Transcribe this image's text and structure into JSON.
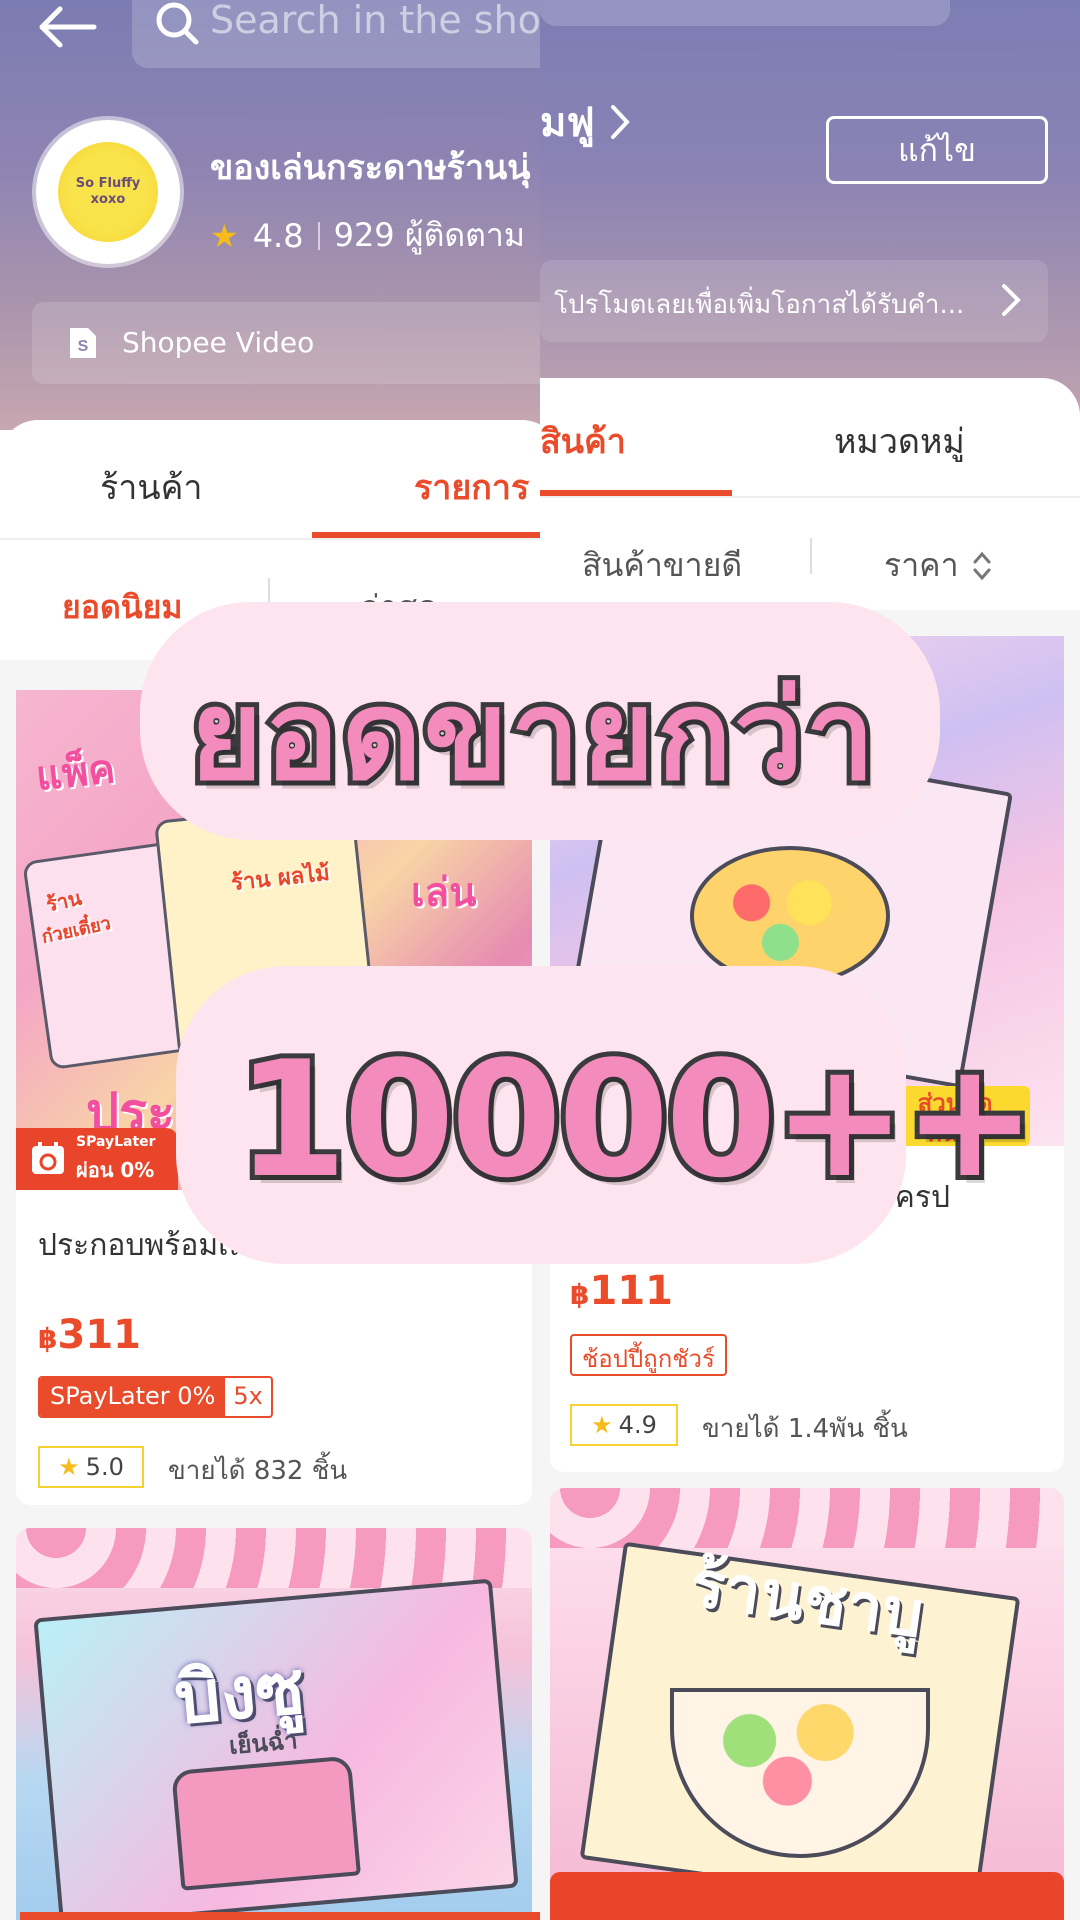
{
  "left": {
    "search": {
      "placeholder": "Search in the shop"
    },
    "shop": {
      "name": "ของเล่นกระดาษร้านนุ่",
      "avatar_text": "So Fluffy\nxoxo",
      "rating": "4.8",
      "followers": "929 ผู้ติดตาม"
    },
    "video": {
      "label": "Shopee Video"
    },
    "tabs": [
      "ร้านค้า",
      "รายการ"
    ],
    "sort": [
      "ยอดนิยม",
      "ล่าสุด"
    ],
    "product1": {
      "image_words": [
        "ผ่อน 0%",
        "แพ็ค",
        "เล่น",
        "ประ",
        "ร้าน",
        "ก๋วยเตี๋ยว",
        "ร้าน ผลไม้"
      ],
      "spaylater_tag_top": "SPayLater",
      "spaylater_tag_bottom": "ผ่อน 0%",
      "title": "ประกอบพร้อมเล่น ร้านนุ่มฟู",
      "currency": "฿",
      "price": "311",
      "spaylater_label": "SPayLater 0%",
      "spaylater_multiplier": "5x",
      "rating": "5.0",
      "sold": "ขายได้ 832 ชิ้น"
    },
    "product2": {
      "image_title": "บิงซู",
      "image_sub": "เย็นฉ่ำ"
    }
  },
  "right": {
    "shop_name_partial": "ุ่มฟู",
    "edit_button": "แก้ไข",
    "promo_text": "โปรโมตเลยเพื่อเพิ่มโอกาสได้รับคำ...",
    "tabs": [
      "สินค้า",
      "หมวดหมู่"
    ],
    "sort": [
      "สินค้าขายดี",
      "ราคา"
    ],
    "product1": {
      "sale_tag": "ส่วนลด\nทันใจ",
      "title_partial": "นเครป",
      "currency": "฿",
      "price": "111",
      "badge": "ช้อปปี้ถูกชัวร์",
      "rating": "4.9",
      "sold": "ขายได้ 1.4พัน ชิ้น"
    },
    "product2": {
      "image_title": "ร้านชาบู"
    }
  },
  "overlay": {
    "line1": "ยอดขายกว่า",
    "line2": "10000++"
  },
  "colors": {
    "accent": "#e94b2b",
    "header_gradient_top": "#7b7cb2",
    "overlay_pill": "#fde4ee",
    "overlay_text": "#f48bbd",
    "rating_star": "#f5bc1c"
  }
}
